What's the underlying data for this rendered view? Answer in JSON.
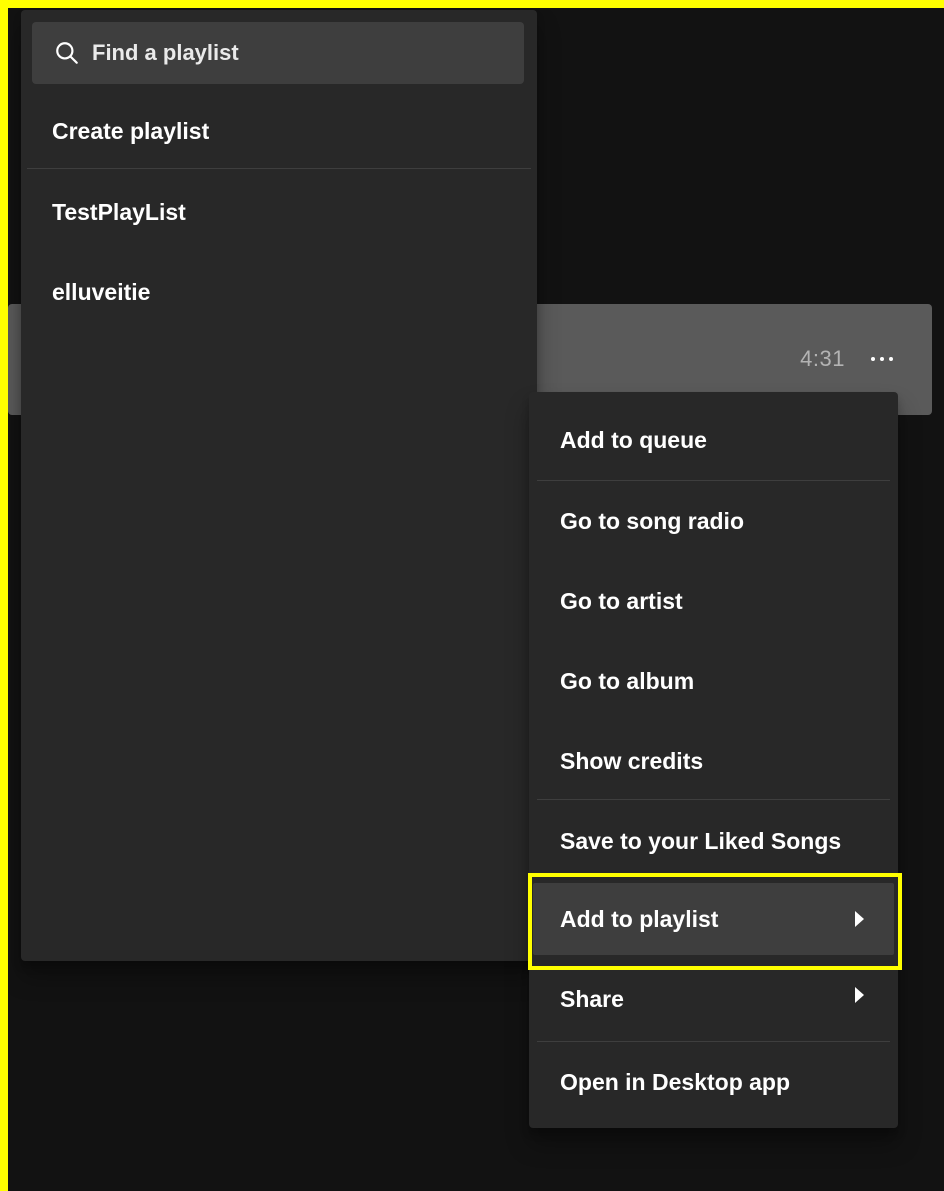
{
  "track": {
    "duration": "4:31",
    "more_icon": "more-horizontal-icon"
  },
  "playlist_menu": {
    "search": {
      "placeholder": "Find a playlist",
      "value": "",
      "icon": "search-icon"
    },
    "create_label": "Create playlist",
    "playlists": [
      {
        "name": "TestPlayList"
      },
      {
        "name": "elluveitie"
      }
    ]
  },
  "context_menu": {
    "items": [
      {
        "label": "Add to queue"
      },
      {
        "label": "Go to song radio"
      },
      {
        "label": "Go to artist"
      },
      {
        "label": "Go to album"
      },
      {
        "label": "Show credits"
      },
      {
        "label": "Save to your Liked Songs"
      },
      {
        "label": "Add to playlist",
        "submenu": true,
        "active": true
      },
      {
        "label": "Share",
        "submenu": true
      },
      {
        "label": "Open in Desktop app"
      }
    ]
  },
  "colors": {
    "background": "#121212",
    "menu_bg": "#282828",
    "hover_bg": "#3e3e3e",
    "highlight": "#ffff00",
    "track_row": "#5a5a5a",
    "muted_text": "#b3b3b3"
  }
}
